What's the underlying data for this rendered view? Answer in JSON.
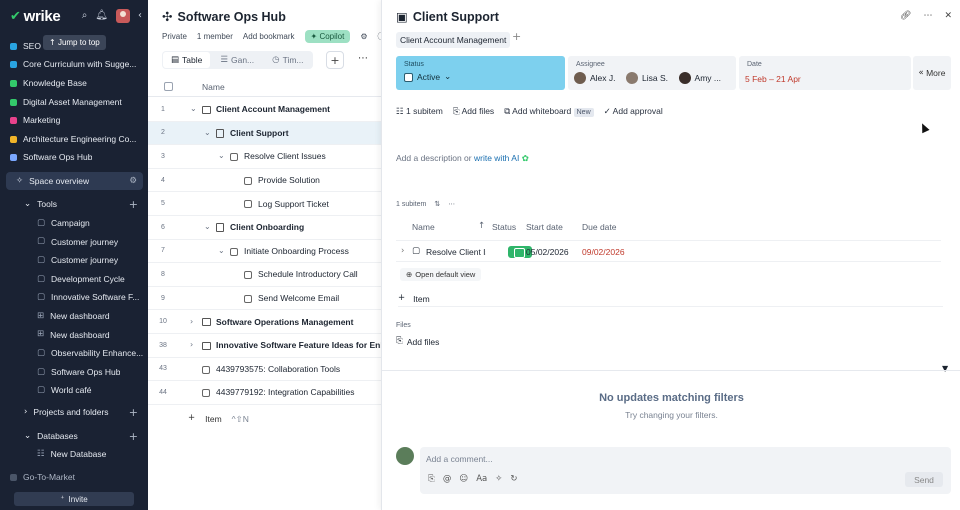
{
  "app": {
    "logo": "wrike",
    "jump_tooltip": "Jump to top",
    "invite_label": "Invite"
  },
  "sidebar": {
    "items": [
      {
        "label": "SEO S",
        "color": "#29a3e0"
      },
      {
        "label": "Core Curriculum with Sugge...",
        "color": "#29a3e0"
      },
      {
        "label": "Knowledge Base",
        "color": "#33c96b"
      },
      {
        "label": "Digital Asset Management",
        "color": "#33c96b"
      },
      {
        "label": "Marketing",
        "color": "#e8428c"
      },
      {
        "label": "Architecture Engineering Co...",
        "color": "#f0b429"
      },
      {
        "label": "Software Ops Hub",
        "color": "#7aa7ff"
      }
    ],
    "space_overview": "Space overview",
    "tools_label": "Tools",
    "tools": [
      "Campaign",
      "Customer journey",
      "Customer journey",
      "Development Cycle",
      "Innovative Software F...",
      "New dashboard",
      "New dashboard",
      "Observability Enhance...",
      "Software Ops Hub",
      "World café"
    ],
    "projects_label": "Projects and folders",
    "databases_label": "Databases",
    "database_items": [
      "New Database"
    ],
    "go_to_market": "Go-To-Market"
  },
  "middle": {
    "title": "Software Ops Hub",
    "meta": {
      "privacy": "Private",
      "members": "1 member",
      "bookmark": "Add bookmark",
      "copilot": "Copilot"
    },
    "views": [
      {
        "label": "Table"
      },
      {
        "label": "Gan..."
      },
      {
        "label": "Tim..."
      }
    ],
    "column_name": "Name",
    "rows": [
      {
        "num": "1",
        "name": "Client Account Management",
        "level": 0,
        "type": "folder",
        "expanded": true,
        "bold": true
      },
      {
        "num": "2",
        "name": "Client Support",
        "level": 1,
        "type": "proj",
        "expanded": true,
        "bold": true,
        "selected": true
      },
      {
        "num": "3",
        "name": "Resolve Client Issues",
        "level": 2,
        "type": "task",
        "expanded": true
      },
      {
        "num": "4",
        "name": "Provide Solution",
        "level": 3,
        "type": "task"
      },
      {
        "num": "5",
        "name": "Log Support Ticket",
        "level": 3,
        "type": "task"
      },
      {
        "num": "6",
        "name": "Client Onboarding",
        "level": 1,
        "type": "proj",
        "expanded": true,
        "bold": true
      },
      {
        "num": "7",
        "name": "Initiate Onboarding Process",
        "level": 2,
        "type": "task",
        "expanded": true
      },
      {
        "num": "8",
        "name": "Schedule Introductory Call",
        "level": 3,
        "type": "task"
      },
      {
        "num": "9",
        "name": "Send Welcome Email",
        "level": 3,
        "type": "task"
      },
      {
        "num": "10",
        "name": "Software Operations Management",
        "level": 0,
        "type": "folder",
        "collapsed": true,
        "bold": true
      },
      {
        "num": "38",
        "name": "Innovative Software Feature Ideas for Enha",
        "level": 0,
        "type": "folder",
        "collapsed": true,
        "bold": true
      },
      {
        "num": "43",
        "name": "4439793575: Collaboration Tools",
        "level": 0,
        "type": "task"
      },
      {
        "num": "44",
        "name": "4439779192: Integration Capabilities",
        "level": 0,
        "type": "task"
      }
    ],
    "add_item": "Item",
    "add_shortcut": "^⇧N"
  },
  "panel": {
    "title": "Client Support",
    "parent_chip": "Client Account Management",
    "status_label": "Status",
    "status_value": "Active",
    "assignee_label": "Assignee",
    "assignees": [
      "Alex J.",
      "Lisa S.",
      "Amy ..."
    ],
    "date_label": "Date",
    "date_value": "5 Feb – 21 Apr",
    "more_label": "More",
    "actions": {
      "subitem": "1 subitem",
      "files": "Add files",
      "whiteboard": "Add whiteboard",
      "new_badge": "New",
      "approval": "Add approval"
    },
    "description": {
      "prefix": "Add a description or",
      "ai_link": "write with AI"
    },
    "subitems": {
      "count": "1 subitem",
      "columns": {
        "name": "Name",
        "status": "Status",
        "start": "Start date",
        "due": "Due date"
      },
      "rows": [
        {
          "name": "Resolve Client Is",
          "start": "05/02/2026",
          "due": "09/02/2026"
        }
      ],
      "open_view": "Open default view",
      "add_item": "Item"
    },
    "files_label": "Files",
    "files_add": "Add files",
    "empty_title": "No updates matching filters",
    "empty_sub": "Try changing your filters.",
    "comment_placeholder": "Add a comment...",
    "send_label": "Send"
  },
  "colors": {
    "sidebar_bg": "#1a2233",
    "status_field": "#7dd0ee",
    "due_overdue": "#c0392b",
    "brand_green": "#33c96b"
  }
}
